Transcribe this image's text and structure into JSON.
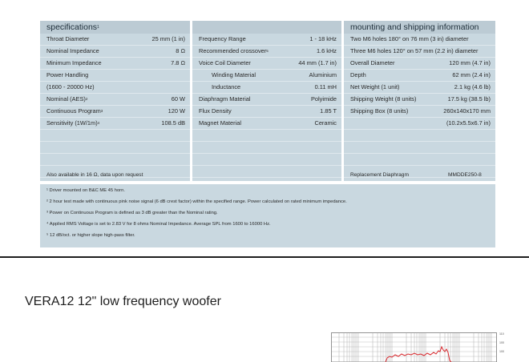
{
  "specifications": {
    "title": "specifications",
    "title_sup": "1",
    "left": [
      {
        "label": "Throat Diameter",
        "sup": "",
        "value": "25 mm (1 in)"
      },
      {
        "label": "Nominal Impedance",
        "sup": "",
        "value": "8 Ω"
      },
      {
        "label": "Minimum Impedance",
        "sup": "",
        "value": "7.8 Ω"
      },
      {
        "label": "Power Handling",
        "sup": "",
        "value": ""
      },
      {
        "label": "(1600 - 20000 Hz)",
        "sup": "",
        "value": ""
      },
      {
        "label": "Nominal (AES)",
        "sup": "2",
        "value": "60 W"
      },
      {
        "label": "Continuous Program",
        "sup": "3",
        "value": "120 W"
      },
      {
        "label": "Sensitivity (1W/1m)",
        "sup": "4",
        "value": "108.5 dB"
      }
    ],
    "middle": [
      {
        "label": "Frequency Range",
        "sup": "",
        "value": "1 - 18 kHz",
        "indent": false
      },
      {
        "label": "Recommended crossover",
        "sup": "5",
        "value": "1.6 kHz",
        "indent": false
      },
      {
        "label": "Voice Coil Diameter",
        "sup": "",
        "value": "44 mm (1.7 in)",
        "indent": false
      },
      {
        "label": "Winding Material",
        "sup": "",
        "value": "Aluminium",
        "indent": true
      },
      {
        "label": "Inductance",
        "sup": "",
        "value": "0.11 mH",
        "indent": true
      },
      {
        "label": "Diaphragm Material",
        "sup": "",
        "value": "Polyimide",
        "indent": false
      },
      {
        "label": "Flux Density",
        "sup": "",
        "value": "1.85 T",
        "indent": false
      },
      {
        "label": "Magnet Material",
        "sup": "",
        "value": "Ceramic",
        "indent": false
      }
    ],
    "footnote_left": "Also available in 16 Ω, data upon request"
  },
  "mounting": {
    "title": "mounting and shipping information",
    "rows": [
      {
        "label": "Two M6 holes 180° on 76 mm (3 in) diameter",
        "value": ""
      },
      {
        "label": "Three M6 holes 120° on 57 mm (2.2 in) diameter",
        "value": ""
      },
      {
        "label": "Overall Diameter",
        "value": "120 mm (4.7 in)"
      },
      {
        "label": "Depth",
        "value": "62 mm (2.4 in)"
      },
      {
        "label": "Net Weight (1 unit)",
        "value": "2.1 kg (4.6 lb)"
      },
      {
        "label": "Shipping Weight (8 units)",
        "value": "17.5 kg (38.5 lb)"
      },
      {
        "label": "Shipping Box (8 units)",
        "value": "260x140x170 mm"
      },
      {
        "label": "",
        "value": "(10.2x5.5x6.7 in)"
      }
    ],
    "replacement_label": "Replacement Diaphragm",
    "replacement_value": "MMDDE250-8"
  },
  "notes": [
    "¹ Driver mounted on B&C ME 45 horn.",
    "² 2 hour test made with continuous pink noise signal (6 dB crest factor) within the specified range. Power calculated on rated minimum impedance.",
    "³ Power on Continuous Program is defined as 3 dB greater than the Nominal rating.",
    "⁴ Applied RMS Voltage is set to 2.83 V for 8 ohms Nominal Impedance. Average SPL from 1600 to 16000 Hz.",
    "⁵ 12 dB/oct. or higher slope high-pass filter."
  ],
  "product_title": "VERA12 12\" low frequency woofer",
  "graph": {
    "y_ticks": [
      "110",
      "100",
      "100"
    ],
    "curve_color": "#d8262b"
  }
}
